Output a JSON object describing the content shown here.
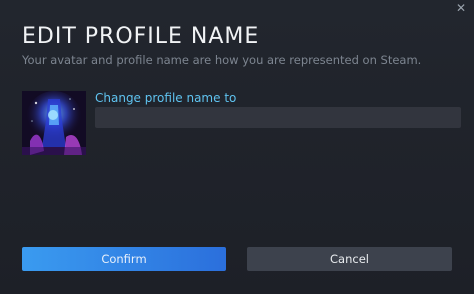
{
  "dialog": {
    "title": "EDIT PROFILE NAME",
    "subtitle": "Your avatar and profile name are how you are represented on Steam.",
    "close_icon": "close-icon"
  },
  "profile": {
    "avatar_icon": "avatar-image",
    "name_label": "Change profile name to",
    "name_value": "",
    "name_placeholder": ""
  },
  "buttons": {
    "confirm_label": "Confirm",
    "cancel_label": "Cancel"
  },
  "colors": {
    "background": "#1f232b",
    "accent_label": "#5fc3f0",
    "confirm_start": "#3a9bf0",
    "confirm_end": "#2b6fdc",
    "cancel_bg": "#3d424d",
    "input_bg": "#32353e"
  }
}
